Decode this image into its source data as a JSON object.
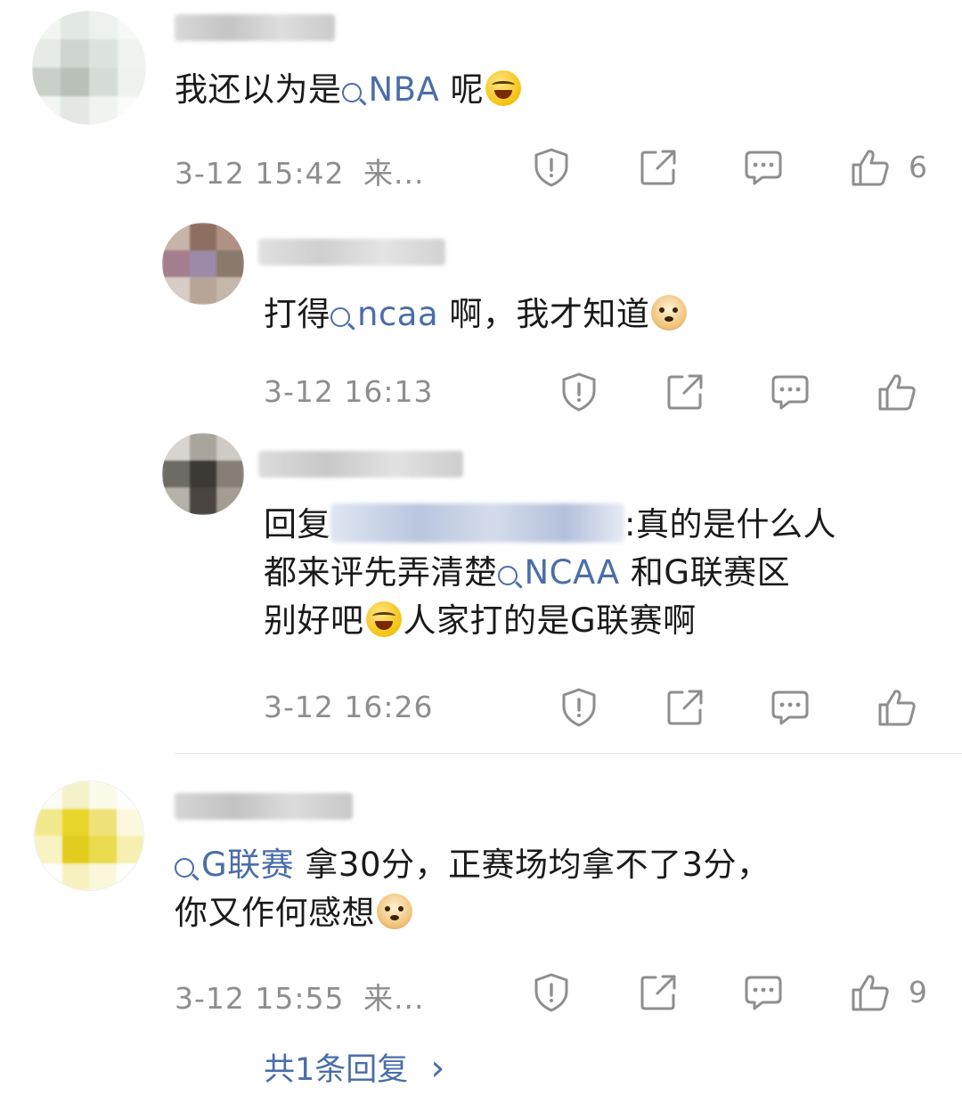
{
  "comments": [
    {
      "text_parts": [
        "我还以为是",
        "NBA",
        " 呢"
      ],
      "time": "3-12 15:42",
      "location": "来...",
      "likes": "6"
    },
    {
      "text_parts": [
        "打得",
        "ncaa",
        " 啊，我才知道"
      ],
      "time": "3-12 16:13",
      "location": "",
      "likes": ""
    },
    {
      "reply_prefix": "回复",
      "line1_rest": ":真的是什么人",
      "line2_pre": "都来评先弄清楚",
      "line2_link": "NCAA",
      "line2_post": " 和G联赛区",
      "line3_pre": "别好吧",
      "line3_post": "人家打的是G联赛啊",
      "time": "3-12 16:26",
      "location": "",
      "likes": ""
    },
    {
      "line1_link": "G联赛",
      "line1_post": " 拿30分，正赛场均拿不了3分，",
      "line2_pre": "你又作何感想",
      "time": "3-12 15:55",
      "location": "来...",
      "likes": "9"
    }
  ],
  "footer": {
    "replies_label": "共1条回复",
    "chevron": "›"
  },
  "icons": [
    "report-icon",
    "share-icon",
    "comment-icon",
    "like-icon",
    "search-link-icon",
    "laugh-cry-emoji",
    "doge-emoji"
  ],
  "colors": {
    "link": "#4a6ea8",
    "meta": "#8e8e8e",
    "text": "#1a1a1a",
    "divider": "#e6e6e6"
  }
}
